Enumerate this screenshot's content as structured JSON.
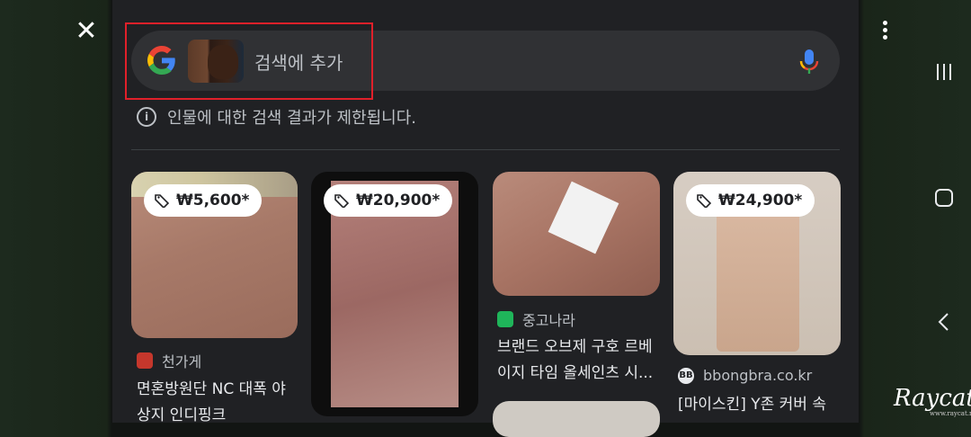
{
  "search": {
    "placeholder": "검색에 추가"
  },
  "notice": {
    "text": "인물에 대한 검색 결과가 제한됩니다."
  },
  "results": [
    {
      "price": "₩5,600*",
      "source": "천가게",
      "title_line1": "면혼방원단 NC 대폭 야",
      "title_line2": "상지 인디핑크"
    },
    {
      "price": "₩20,900*"
    },
    {
      "source": "중고나라",
      "title_line1": "브랜드 오브제 구호 르베",
      "title_line2": "이지 타임 올세인츠 시..."
    },
    {
      "price": "₩24,900*",
      "source_icon_text": "BB",
      "source": "bbongbra.co.kr",
      "title_line1": "[마이스킨] Y존 커버 속"
    }
  ],
  "watermark": {
    "text": "Raycat",
    "sub": "www.raycat.net"
  },
  "colors": {
    "accent_red": "#e0202a",
    "panel": "#202124"
  }
}
